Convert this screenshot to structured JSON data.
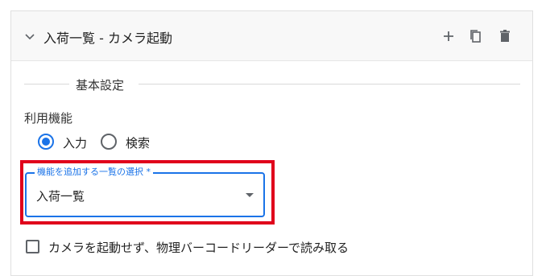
{
  "panel": {
    "title": "入荷一覧 - カメラ起動",
    "icons": [
      "chevron-down-icon",
      "plus-icon",
      "copy-icon",
      "trash-icon"
    ]
  },
  "section": {
    "title": "基本設定"
  },
  "function": {
    "label": "利用機能",
    "options": [
      {
        "label": "入力",
        "checked": true
      },
      {
        "label": "検索",
        "checked": false
      }
    ]
  },
  "list_select": {
    "label": "機能を追加する一覧の選択 *",
    "value": "入荷一覧"
  },
  "camera_option": {
    "label": "カメラを起動せず、物理バーコードリーダーで読み取る",
    "checked": false
  },
  "colors": {
    "accent": "#1a73e8",
    "highlight": "#e0001b"
  }
}
